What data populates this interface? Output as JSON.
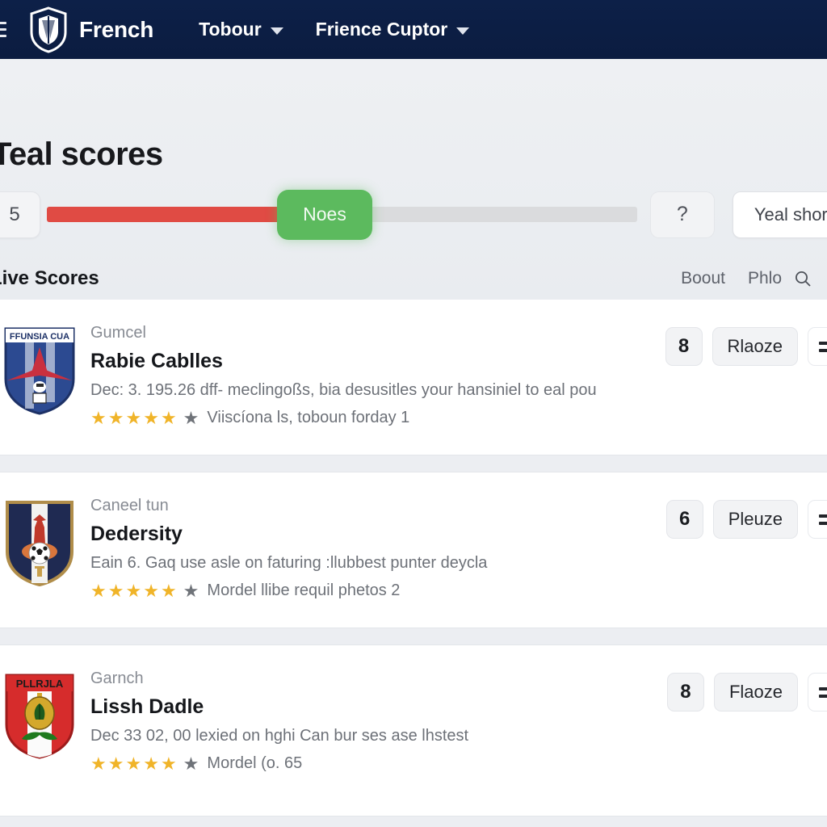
{
  "topbar": {
    "menu_icon": "hamburger-icon",
    "logo_icon": "shield-crest-logo",
    "brand": "French",
    "nav": [
      {
        "label": "Tobour",
        "caret": "chevron-down-icon"
      },
      {
        "label": "Frience Cuptor",
        "caret": "chevron-down-icon"
      }
    ],
    "background_color": "#0e2148"
  },
  "hero": {
    "title": "Teal scores"
  },
  "slider": {
    "step_value": "5",
    "thumb_label": "Noes",
    "help_label": "?",
    "share_label": "Yeal shore",
    "fill_color": "#e04b44",
    "thumb_color": "#5cba5e",
    "track_color": "#dadbdd",
    "fill_percent": 46
  },
  "section": {
    "title": "Live Scores",
    "actions": [
      {
        "label": "Boout"
      },
      {
        "label": "Phlo"
      }
    ],
    "search_icon": "search-icon"
  },
  "list": {
    "items": [
      {
        "crest": "ffunsia-cup-crest",
        "crest_text": "FFUNSIA CUA",
        "eyebrow": "Gumcel",
        "title": "Rabie Cablles",
        "description": "Dec: 3. 195.26 dff- meclingoßs, bia desusitles your hansiniel to eal pou",
        "stars_filled": 5,
        "stars_total": 6,
        "rating_text": "Viiscíona ls, toboun forday 1",
        "score": "8",
        "status": "Rlaoze",
        "more_icon": "more-menu-icon"
      },
      {
        "crest": "dedersity-crest",
        "crest_text": "",
        "eyebrow": "Caneel tun",
        "title": "Dedersity",
        "description": "Eain 6. Gaq use asle on faturing :llubbest punter deycla",
        "stars_filled": 5,
        "stars_total": 6,
        "rating_text": "Mordel llibe requil phetos 2",
        "score": "6",
        "status": "Pleuze",
        "more_icon": "more-menu-icon"
      },
      {
        "crest": "pllrjla-crest",
        "crest_text": "PLLRJLA",
        "eyebrow": "Garnch",
        "title": "Lissh Dadle",
        "description": "Dec 33 02, 00 lexied on hghi Can bur ses ase lhstest",
        "stars_filled": 5,
        "stars_total": 6,
        "rating_text": "Mordel (o. 65",
        "score": "8",
        "status": "Flaoze",
        "more_icon": "more-menu-icon"
      }
    ]
  }
}
